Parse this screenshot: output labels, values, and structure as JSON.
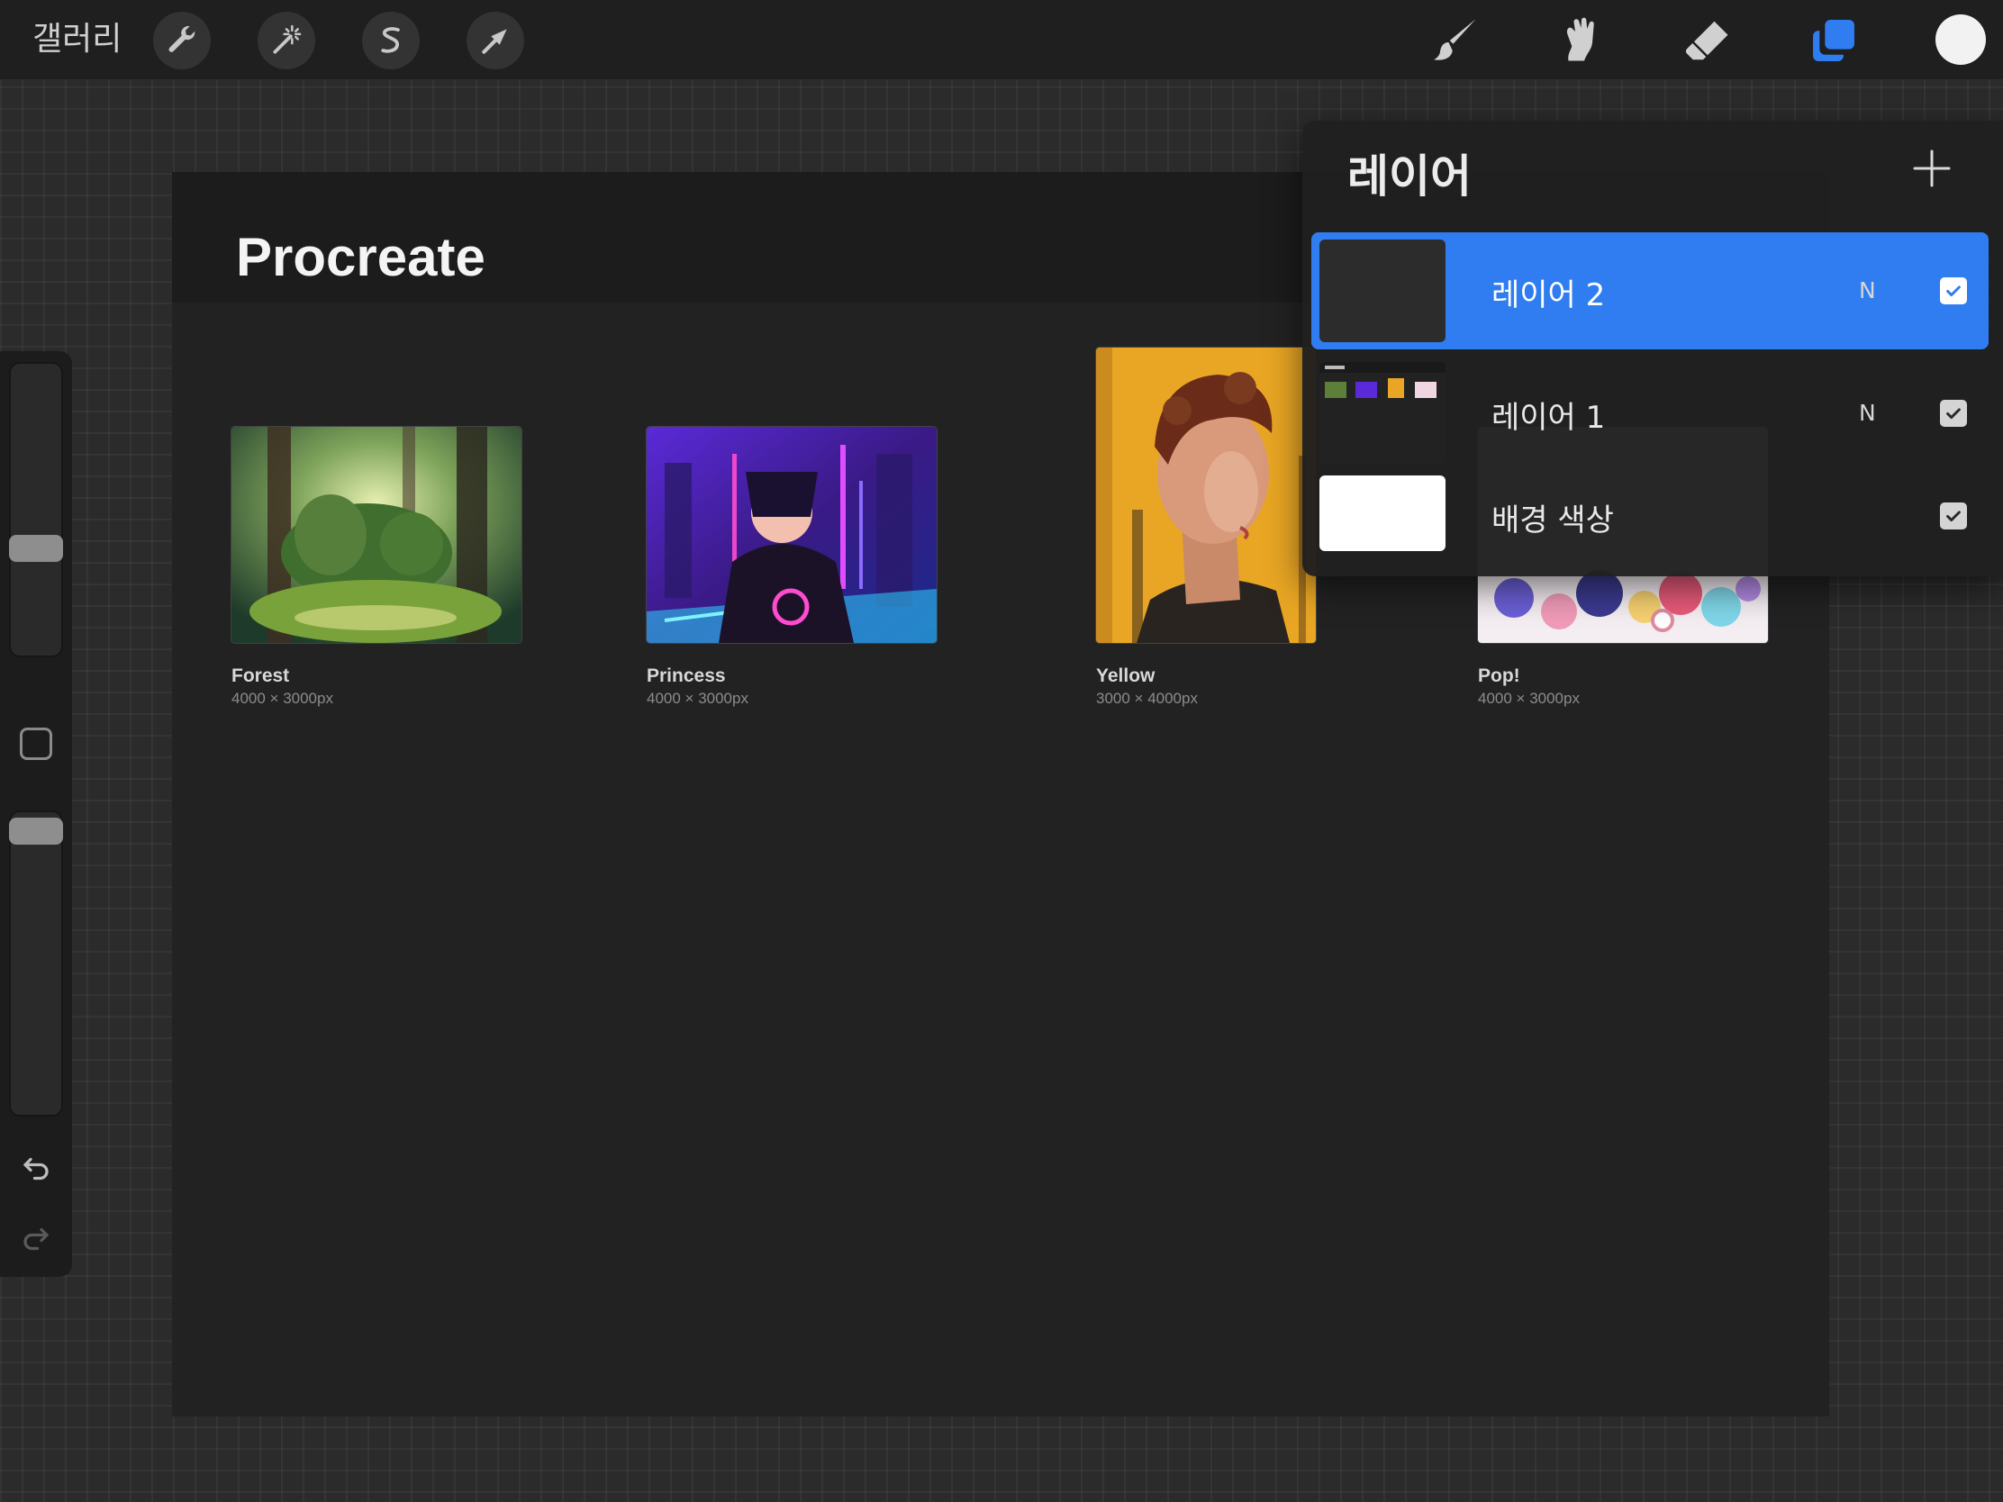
{
  "toolbar": {
    "gallery_label": "갤러리",
    "left_tools": [
      "wrench-icon",
      "magic-wand-icon",
      "selection-icon",
      "transform-arrow-icon"
    ],
    "right_tools": [
      "brush-icon",
      "smudge-icon",
      "eraser-icon",
      "layers-icon"
    ],
    "active_tool": "layers-icon",
    "accent_color": "#2f7df0",
    "current_color": "#f2f2f2"
  },
  "sidebar": {
    "brush_size_level": 0.62,
    "opacity_level": 0.04,
    "icons": [
      "modify-square-icon",
      "undo-icon",
      "redo-icon"
    ]
  },
  "canvas": {
    "title": "Procreate",
    "artworks": [
      {
        "name": "Forest",
        "size": "4000 × 3000px"
      },
      {
        "name": "Princess",
        "size": "4000 × 3000px"
      },
      {
        "name": "Yellow",
        "size": "3000 × 4000px"
      },
      {
        "name": "Pop!",
        "size": "4000 × 3000px"
      }
    ]
  },
  "layers": {
    "title": "레이어",
    "add_icon": "plus-icon",
    "items": [
      {
        "name": "레이어 2",
        "blend": "N",
        "visible": true,
        "active": true
      },
      {
        "name": "레이어 1",
        "blend": "N",
        "visible": true,
        "active": false
      },
      {
        "name": "배경 색상",
        "blend": "",
        "visible": true,
        "active": false,
        "background_color": "#ffffff"
      }
    ]
  }
}
